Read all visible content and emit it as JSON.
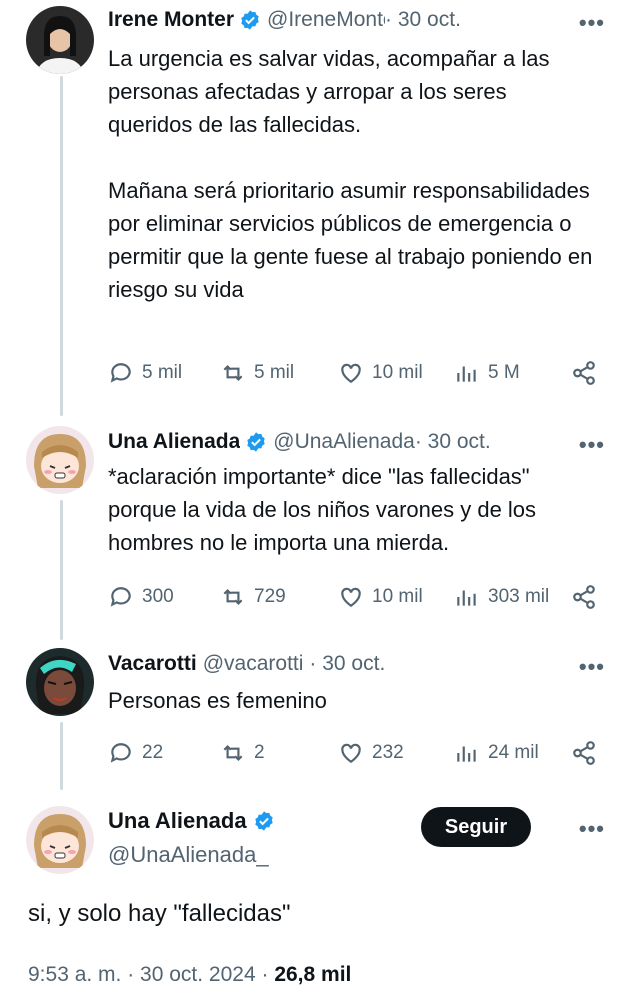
{
  "tweets": [
    {
      "name": "Irene Monter",
      "handle": "@IreneMonter",
      "date": "· 30 oct.",
      "more": "•••",
      "text": "La urgencia es salvar vidas, acompañar a las personas afectadas y arropar a los seres queridos de las fallecidas.\n\nMañana será prioritario asumir responsabilidades por eliminar servicios públicos de emergencia o permitir que la gente fuese al trabajo poniendo en riesgo su vida",
      "replies": "5 mil",
      "retweets": "5 mil",
      "likes": "10 mil",
      "views": "5 M"
    },
    {
      "name": "Una Alienada",
      "handle": "@UnaAlienada",
      "date": "· 30 oct.",
      "more": "•••",
      "text": "*aclaración importante* dice \"las fallecidas\" porque la vida de los niños varones y de los hombres no le importa una mierda.",
      "replies": "300",
      "retweets": "729",
      "likes": "10 mil",
      "views": "303 mil"
    },
    {
      "name": "Vacarotti",
      "handle": "@vacarotti",
      "date": "· 30 oct.",
      "more": "•••",
      "text": "Personas es femenino",
      "replies": "22",
      "retweets": "2",
      "likes": "232",
      "views": "24 mil"
    }
  ],
  "main": {
    "name": "Una Alienada",
    "handle": "@UnaAlienada_",
    "follow_label": "Seguir",
    "more": "•••",
    "text": "si, y solo hay \"fallecidas\"",
    "time": "9:53 a. m. · 30 oct. 2024 · ",
    "views": "26,8 mil"
  },
  "icons": [
    "reply-icon",
    "retweet-icon",
    "like-icon",
    "views-icon",
    "share-icon",
    "verified-badge-icon",
    "more-icon"
  ],
  "colors": {
    "verified": "#1d9bf0",
    "muted": "#536471",
    "text": "#0f1419",
    "line": "#cfd9de"
  }
}
